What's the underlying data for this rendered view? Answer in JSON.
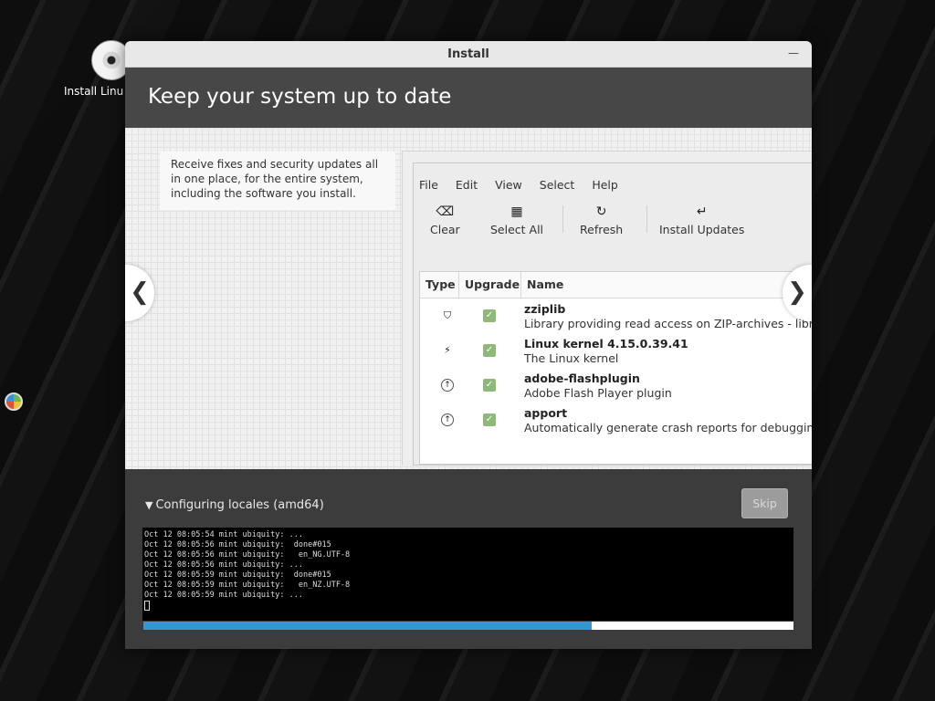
{
  "desktop": {
    "icon_label": "Install Linu",
    "icon_name": "disc-icon"
  },
  "window": {
    "title": "Install",
    "header": "Keep your system up to date"
  },
  "slide": {
    "text": "Receive fixes and security updates all in one place, for the entire system, including the software you install.",
    "menu": [
      "File",
      "Edit",
      "View",
      "Select",
      "Help"
    ],
    "toolbar": [
      {
        "icon": "backspace-icon",
        "label": "Clear"
      },
      {
        "icon": "select-all-icon",
        "label": "Select All"
      },
      {
        "icon": "refresh-icon",
        "label": "Refresh"
      },
      {
        "icon": "return-icon",
        "label": "Install Updates"
      }
    ],
    "columns": [
      "Type",
      "Upgrade",
      "Name"
    ],
    "packages": [
      {
        "type_icon": "shield-icon",
        "upgrade": true,
        "name": "zziplib",
        "description": "Library providing read access on ZIP-archives - library"
      },
      {
        "type_icon": "lightning-icon",
        "upgrade": true,
        "name": "Linux kernel 4.15.0.39.41",
        "description": "The Linux kernel"
      },
      {
        "type_icon": "up-arrow-icon",
        "upgrade": true,
        "name": "adobe-flashplugin",
        "description": "Adobe Flash Player plugin"
      },
      {
        "type_icon": "up-arrow-icon",
        "upgrade": true,
        "name": "apport",
        "description": "Automatically generate crash reports for debugging"
      }
    ]
  },
  "progress": {
    "status": "Configuring locales (amd64)",
    "skip_label": "Skip",
    "log": [
      "Oct 12 08:05:54 mint ubiquity: ...",
      "Oct 12 08:05:56 mint ubiquity:  done#015",
      "Oct 12 08:05:56 mint ubiquity:   en_NG.UTF-8",
      "Oct 12 08:05:56 mint ubiquity: ...",
      "Oct 12 08:05:59 mint ubiquity:  done#015",
      "Oct 12 08:05:59 mint ubiquity:   en_NZ.UTF-8",
      "Oct 12 08:05:59 mint ubiquity: ..."
    ],
    "percent": 69,
    "accent": "#3696d3"
  }
}
